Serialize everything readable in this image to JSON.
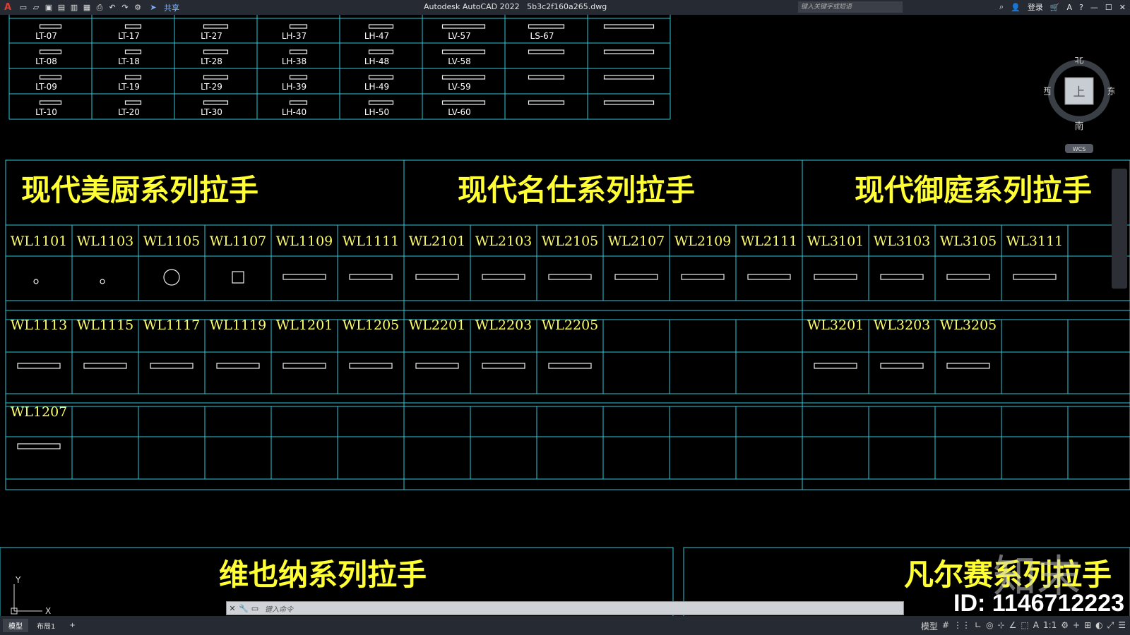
{
  "titlebar": {
    "app_name": "Autodesk AutoCAD 2022",
    "file_name": "5b3c2f160a265.dwg",
    "share_label": "共享",
    "search_placeholder": "键入关键字或短语",
    "login_label": "登录"
  },
  "top_grid": {
    "rows": [
      [
        "LT-07",
        "LT-17",
        "LT-27",
        "LH-37",
        "LH-47",
        "LV-57",
        "LS-67",
        ""
      ],
      [
        "LT-08",
        "LT-18",
        "LT-28",
        "LH-38",
        "LH-48",
        "LV-58",
        "",
        ""
      ],
      [
        "LT-09",
        "LT-19",
        "LT-29",
        "LH-39",
        "LH-49",
        "LV-59",
        "",
        ""
      ],
      [
        "LT-10",
        "LT-20",
        "LT-30",
        "LH-40",
        "LH-50",
        "LV-60",
        "",
        ""
      ]
    ]
  },
  "series_headers": [
    "现代美厨系列拉手",
    "现代名仕系列拉手",
    "现代御庭系列拉手"
  ],
  "table": {
    "row1": [
      "WL1101",
      "WL1103",
      "WL1105",
      "WL1107",
      "WL1109",
      "WL1111",
      "WL2101",
      "WL2103",
      "WL2105",
      "WL2107",
      "WL2109",
      "WL2111",
      "WL3101",
      "WL3103",
      "WL3105",
      "WL3111"
    ],
    "row2": [
      "WL1113",
      "WL1115",
      "WL1117",
      "WL1119",
      "WL1201",
      "WL1205",
      "WL2201",
      "WL2203",
      "WL2205",
      "",
      "",
      "",
      "WL3201",
      "WL3203",
      "WL3205"
    ],
    "row3": [
      "WL1207"
    ]
  },
  "bottom_headers": [
    "维也纳系列拉手",
    "凡尔赛系列拉手"
  ],
  "viewcube": {
    "north": "北",
    "south": "南",
    "east": "东",
    "west": "西",
    "top": "上",
    "wcs": "WCS"
  },
  "ucs": {
    "x": "X",
    "y": "Y"
  },
  "command": {
    "placeholder": "键入命令"
  },
  "status": {
    "tab_model": "模型",
    "tab_layout1": "布局1",
    "model_label": "模型",
    "scale": "1:1"
  },
  "watermark": {
    "logo": "知末",
    "id": "ID: 1146712223"
  }
}
